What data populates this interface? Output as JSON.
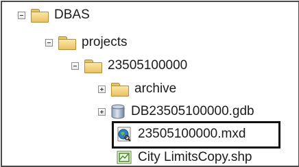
{
  "tree": {
    "dbas": {
      "label": "DBAS"
    },
    "projects": {
      "label": "projects"
    },
    "project_folder": {
      "label": "23505100000"
    },
    "archive": {
      "label": "archive"
    },
    "gdb": {
      "label": "DB23505100000.gdb"
    },
    "mxd": {
      "label": "23505100000.mxd"
    },
    "shp": {
      "label": "City LimitsCopy.shp"
    }
  }
}
